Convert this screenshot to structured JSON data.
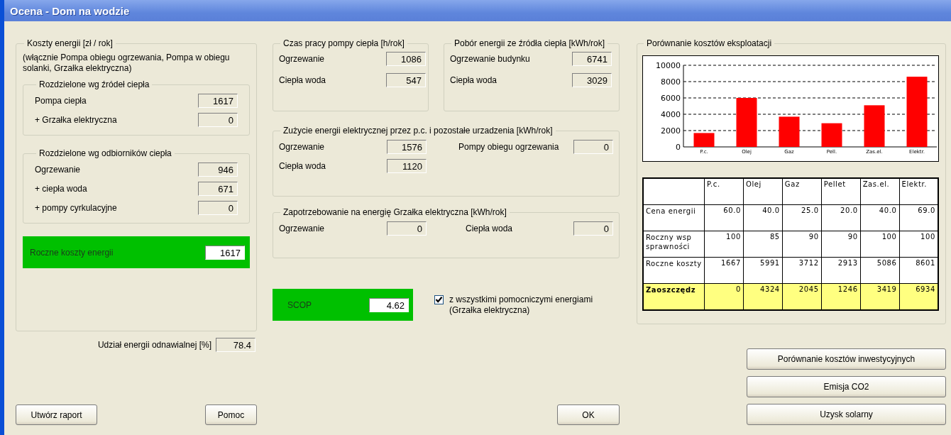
{
  "window": {
    "title": "Ocena - Dom na wodzie"
  },
  "energy_costs": {
    "title": "Koszty energii [zł / rok]",
    "note": "(włącznie Pompa obiegu ogrzewania, Pompa w obiegu solanki, Grzałka elektryczna)",
    "groups": [
      {
        "title": "Rozdzielone wg źródeł ciepła",
        "rows": [
          {
            "label": "Pompa ciepła",
            "value": "1617"
          },
          {
            "label": "+ Grzałka elektryczna",
            "value": "0"
          }
        ]
      },
      {
        "title": "Rozdzielone wg odbiorników ciepła",
        "rows": [
          {
            "label": "Ogrzewanie",
            "value": "946"
          },
          {
            "label": "+ ciepła woda",
            "value": "671"
          },
          {
            "label": "+ pompy cyrkulacyjne",
            "value": "0"
          }
        ]
      }
    ],
    "total": {
      "label": "Roczne koszty energii",
      "value": "1617"
    }
  },
  "renewable_share": {
    "label": "Udział energii odnawialnej [%]",
    "value": "78.4"
  },
  "operating_time": {
    "title": "Czas pracy pompy ciepła [h/rok]",
    "rows": [
      {
        "label": "Ogrzewanie",
        "value": "1086"
      },
      {
        "label": "Ciepła woda",
        "value": "547"
      }
    ]
  },
  "source_energy": {
    "title": "Pobór energii ze źródła ciepła [kWh/rok]",
    "rows": [
      {
        "label": "Ogrzewanie budynku",
        "value": "6741"
      },
      {
        "label": "Ciepła woda",
        "value": "3029"
      }
    ]
  },
  "electricity": {
    "title": "Zużycie energii elektrycznej przez p.c. i pozostałe urzadzenia [kWh/rok]",
    "rows": [
      {
        "label": "Ogrzewanie",
        "value": "1576"
      },
      {
        "label": "Ciepła woda",
        "value": "1120"
      }
    ],
    "pumps": {
      "label": "Pompy obiegu ogrzewania",
      "value": "0"
    }
  },
  "heater_demand": {
    "title": "Zapotrzebowanie na energię Grzałka elektryczna [kWh/rok]",
    "items": [
      {
        "label": "Ogrzewanie",
        "value": "0"
      },
      {
        "label": "Ciepła woda",
        "value": "0"
      }
    ]
  },
  "scop": {
    "label": "SCOP",
    "value": "4.62"
  },
  "aux_checkbox": {
    "label": "z wszystkimi pomocniczymi energiami (Grzałka elektryczna)",
    "checked": true
  },
  "comparison": {
    "title": "Porównanie kosztów eksploatacji",
    "chart_data": {
      "type": "bar",
      "categories": [
        "P.c.",
        "Olej",
        "Gaz",
        "Pell.",
        "Zas.el.",
        "Elektr."
      ],
      "series": [
        {
          "color": "#ff0000",
          "values": [
            1700,
            6000,
            3700,
            2900,
            5100,
            8600
          ]
        }
      ],
      "grid": true,
      "ylim": [
        0,
        10000
      ],
      "yticks": [
        0,
        2000,
        4000,
        6000,
        8000,
        10000
      ]
    },
    "table": {
      "columns": [
        "P.c.",
        "Olej",
        "Gaz",
        "Pellet",
        "Zas.el.",
        "Elektr."
      ],
      "rows": [
        {
          "label": "Cena energii",
          "values": [
            "60.0",
            "40.0",
            "25.0",
            "20.0",
            "40.0",
            "69.0"
          ],
          "highlighted": false
        },
        {
          "label": "Roczny wsp sprawności",
          "values": [
            "100",
            "85",
            "90",
            "90",
            "100",
            "100"
          ],
          "highlighted": false
        },
        {
          "label": "Roczne koszty",
          "values": [
            "1667",
            "5991",
            "3712",
            "2913",
            "5086",
            "8601"
          ],
          "highlighted": false
        },
        {
          "label": "Zaoszczędz",
          "values": [
            "0",
            "4324",
            "2045",
            "1246",
            "3419",
            "6934"
          ],
          "highlighted": true
        }
      ]
    }
  },
  "left_buttons": [
    "Utwórz raport",
    "Pomoc"
  ],
  "ok_button": "OK",
  "side_buttons": [
    "Porównanie kosztów inwestycyjnych",
    "Emisja CO2",
    "Uzysk solarny"
  ]
}
